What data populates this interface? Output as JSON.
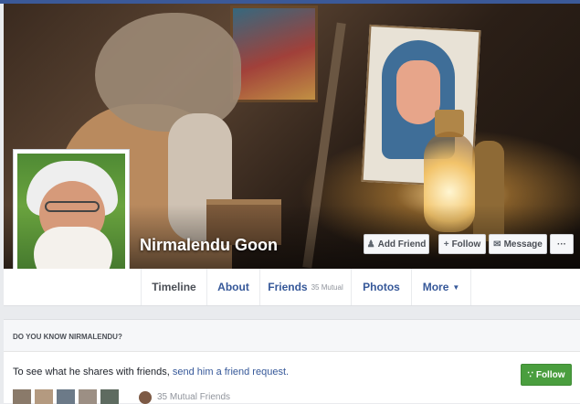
{
  "profile": {
    "name": "Nirmalendu Goon"
  },
  "actions": {
    "add_friend": "Add Friend",
    "follow": "Follow",
    "message": "Message",
    "more": "···"
  },
  "tabs": [
    {
      "label": "Timeline"
    },
    {
      "label": "About"
    },
    {
      "label": "Friends",
      "sub": "35 Mutual"
    },
    {
      "label": "Photos"
    },
    {
      "label": "More"
    }
  ],
  "know_card": {
    "title": "DO YOU KNOW NIRMALENDU?",
    "text_before": "To see what he shares with friends, ",
    "link": "send him a friend request.",
    "follow": "Follow",
    "mutual": "35 Mutual Friends"
  },
  "icons": {
    "add_friend": "add-friend-icon",
    "follow": "plus-icon",
    "message": "message-icon",
    "rss": "rss-icon",
    "more_caret": "caret-down-icon"
  },
  "colors": {
    "brand": "#3b5998",
    "link": "#365899",
    "follow_green": "#4a9e3e"
  }
}
